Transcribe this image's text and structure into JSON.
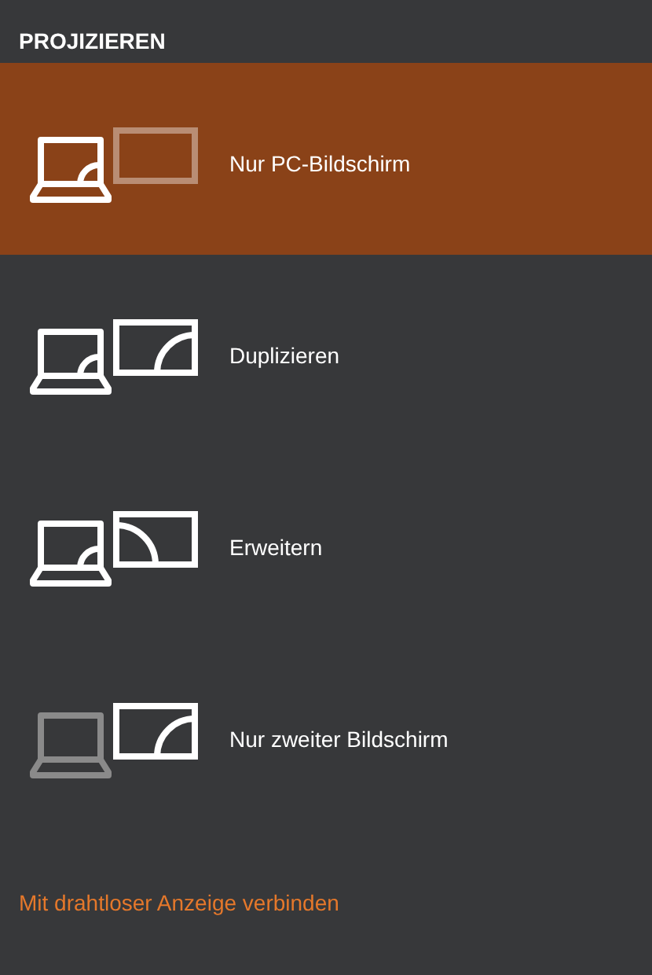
{
  "title": "PROJIZIEREN",
  "options": [
    {
      "label": "Nur PC-Bildschirm",
      "kind": "pc-only",
      "selected": true
    },
    {
      "label": "Duplizieren",
      "kind": "duplicate",
      "selected": false
    },
    {
      "label": "Erweitern",
      "kind": "extend",
      "selected": false
    },
    {
      "label": "Nur zweiter Bildschirm",
      "kind": "second-only",
      "selected": false
    }
  ],
  "link": "Mit drahtloser Anzeige verbinden"
}
